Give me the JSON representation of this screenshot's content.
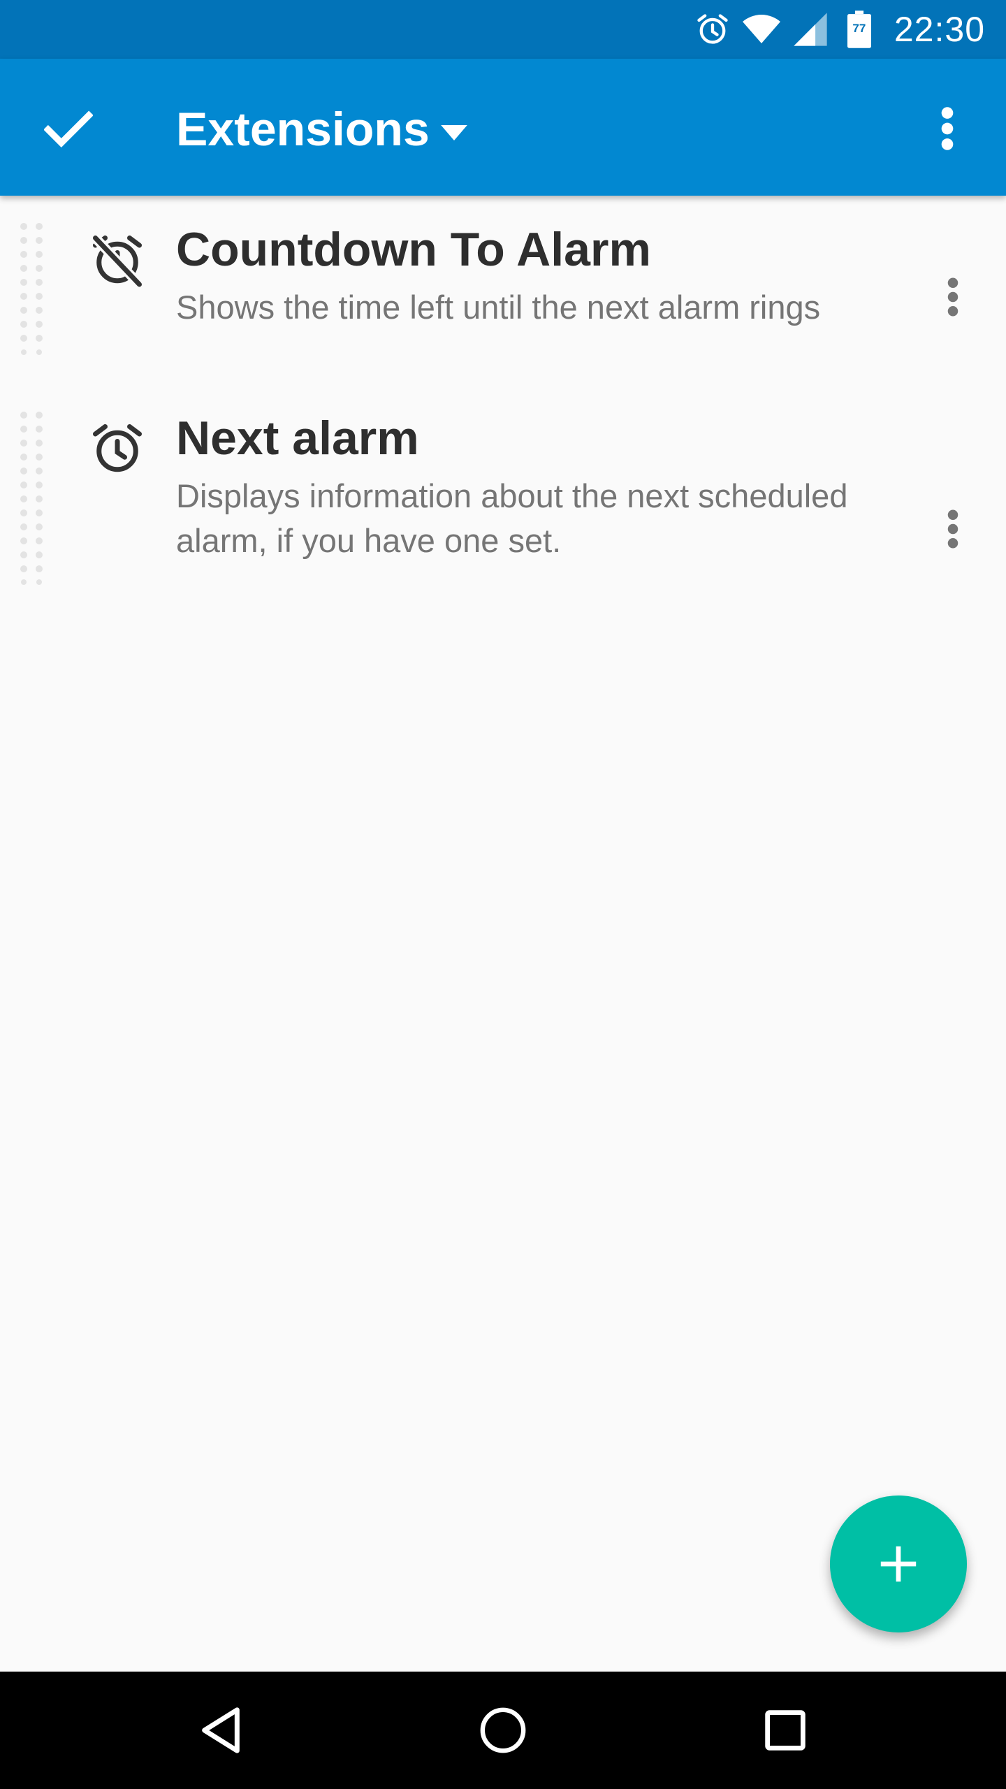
{
  "status_bar": {
    "time": "22:30",
    "battery_level": "77",
    "icons": [
      "alarm-icon",
      "wifi-icon",
      "cell-signal-icon",
      "battery-icon"
    ]
  },
  "app_bar": {
    "title": "Extensions",
    "done_icon": "check-icon",
    "dropdown_icon": "arrow-drop-down-icon",
    "overflow_icon": "more-vert-icon"
  },
  "extensions": [
    {
      "title": "Countdown To Alarm",
      "description": "Shows the time left until the next alarm rings",
      "icon": "alarm-off-icon"
    },
    {
      "title": "Next alarm",
      "description": "Displays information about the next scheduled alarm, if you have one set.",
      "icon": "alarm-clock-icon"
    }
  ],
  "fab": {
    "icon": "plus-icon"
  },
  "nav_bar": {
    "icons": [
      "back-icon",
      "home-icon",
      "recents-icon"
    ]
  },
  "colors": {
    "status_bar": "#0273b8",
    "app_bar": "#0288d1",
    "fab": "#00bfa5",
    "background": "#fafafa",
    "title_text": "#2e2e2e",
    "secondary_text": "#757575"
  }
}
